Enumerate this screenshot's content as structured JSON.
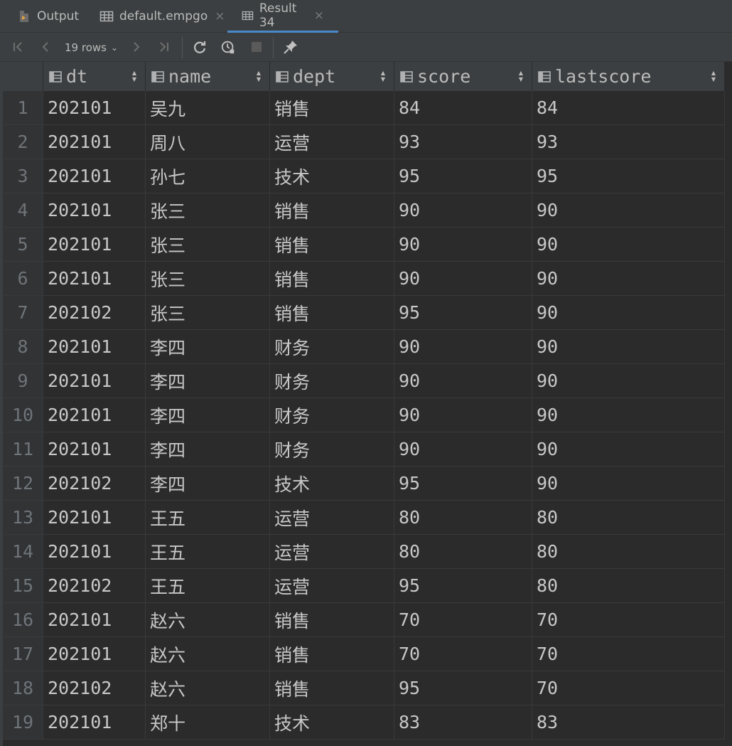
{
  "tabs": [
    {
      "label": "Output",
      "icon": "output-icon",
      "closable": false
    },
    {
      "label": "default.empgo",
      "icon": "table-icon",
      "closable": true
    },
    {
      "label": "Result 34",
      "icon": "table-icon",
      "closable": true,
      "active": true
    }
  ],
  "toolbar": {
    "rows_label": "19 rows",
    "first_icon": "first-page-icon",
    "prev_icon": "prev-page-icon",
    "next_icon": "next-page-icon",
    "last_icon": "last-page-icon",
    "reload_icon": "reload-icon",
    "history_icon": "history-icon",
    "stop_icon": "stop-icon",
    "pin_icon": "pin-icon"
  },
  "columns": [
    "dt",
    "name",
    "dept",
    "score",
    "lastscore"
  ],
  "rows": [
    [
      "1",
      "202101",
      "吴九",
      "销售",
      "84",
      "84"
    ],
    [
      "2",
      "202101",
      "周八",
      "运营",
      "93",
      "93"
    ],
    [
      "3",
      "202101",
      "孙七",
      "技术",
      "95",
      "95"
    ],
    [
      "4",
      "202101",
      "张三",
      "销售",
      "90",
      "90"
    ],
    [
      "5",
      "202101",
      "张三",
      "销售",
      "90",
      "90"
    ],
    [
      "6",
      "202101",
      "张三",
      "销售",
      "90",
      "90"
    ],
    [
      "7",
      "202102",
      "张三",
      "销售",
      "95",
      "90"
    ],
    [
      "8",
      "202101",
      "李四",
      "财务",
      "90",
      "90"
    ],
    [
      "9",
      "202101",
      "李四",
      "财务",
      "90",
      "90"
    ],
    [
      "10",
      "202101",
      "李四",
      "财务",
      "90",
      "90"
    ],
    [
      "11",
      "202101",
      "李四",
      "财务",
      "90",
      "90"
    ],
    [
      "12",
      "202102",
      "李四",
      "技术",
      "95",
      "90"
    ],
    [
      "13",
      "202101",
      "王五",
      "运营",
      "80",
      "80"
    ],
    [
      "14",
      "202101",
      "王五",
      "运营",
      "80",
      "80"
    ],
    [
      "15",
      "202102",
      "王五",
      "运营",
      "95",
      "80"
    ],
    [
      "16",
      "202101",
      "赵六",
      "销售",
      "70",
      "70"
    ],
    [
      "17",
      "202101",
      "赵六",
      "销售",
      "70",
      "70"
    ],
    [
      "18",
      "202102",
      "赵六",
      "销售",
      "95",
      "70"
    ],
    [
      "19",
      "202101",
      "郑十",
      "技术",
      "83",
      "83"
    ]
  ],
  "colors": {
    "accent": "#4a88c7",
    "background": "#2b2b2b",
    "header": "#3c3f41"
  }
}
